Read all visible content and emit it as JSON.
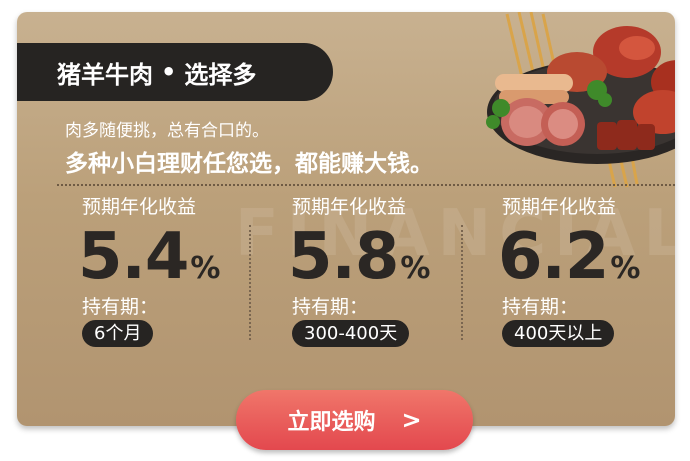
{
  "header": {
    "title_left": "猪羊牛肉",
    "separator": "•",
    "title_right": "选择多"
  },
  "intro": {
    "line1": "肉多随便挑，总有合口的。",
    "line2": "多种小白理财任您选，都能赚大钱。"
  },
  "watermark": "FINANCIAL",
  "products": [
    {
      "yield_label": "预期年化收益",
      "rate": "5.4",
      "unit": "%",
      "hold_label": "持有期：",
      "term": "6个月"
    },
    {
      "yield_label": "预期年化收益",
      "rate": "5.8",
      "unit": "%",
      "hold_label": "持有期：",
      "term": "300-400天"
    },
    {
      "yield_label": "预期年化收益",
      "rate": "6.2",
      "unit": "%",
      "hold_label": "持有期：",
      "term": "400天以上"
    }
  ],
  "cta": {
    "label": "立即选购",
    "arrow": ">"
  },
  "colors": {
    "card_bg": "#bba07a",
    "dark_pill": "#262422",
    "cta_red": "#e3484e",
    "text_white": "#ffffff"
  },
  "icons": {
    "food_illustration": "meat-platter-icon"
  }
}
